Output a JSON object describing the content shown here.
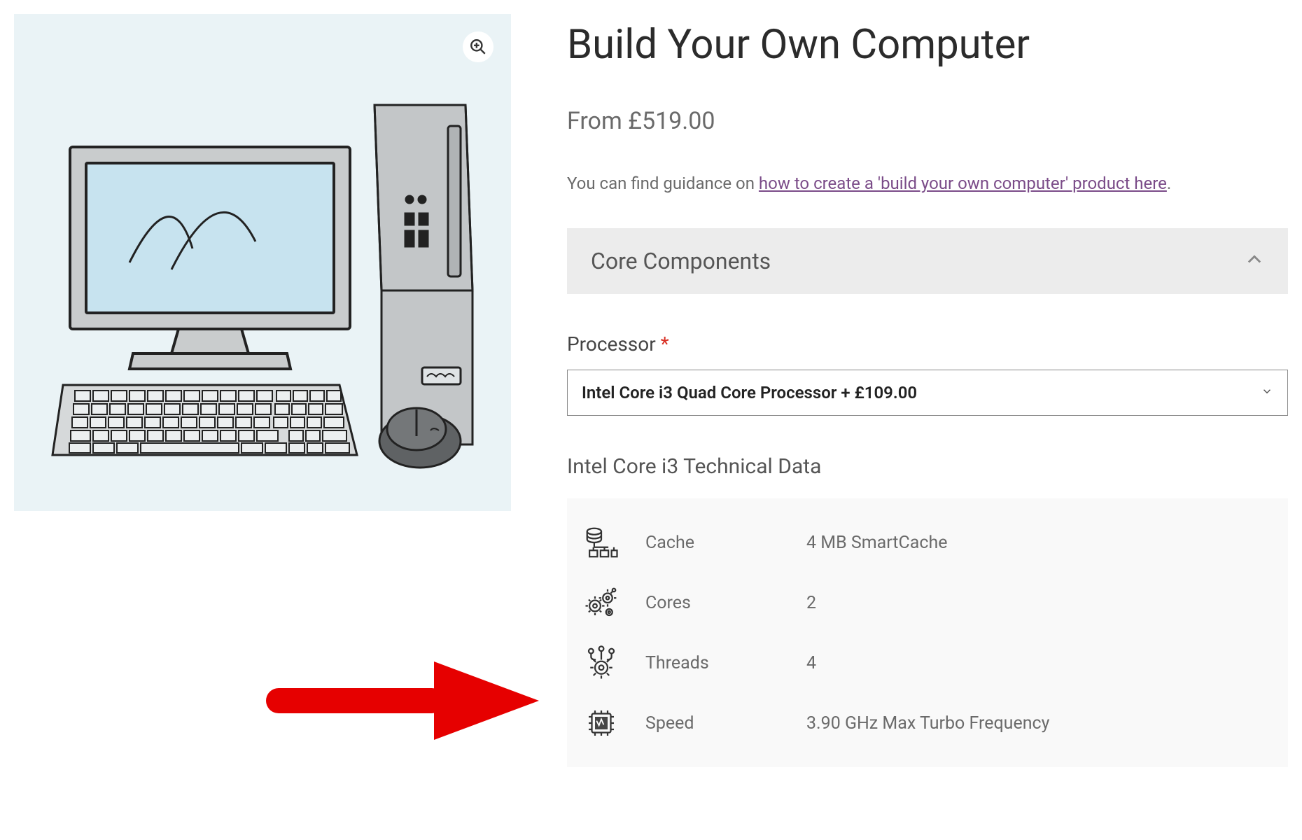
{
  "product": {
    "title": "Build Your Own Computer",
    "price_label": "From £519.00",
    "guidance_prefix": "You can find guidance on ",
    "guidance_link": "how to create a 'build your own computer' product here",
    "guidance_suffix": "."
  },
  "accordion": {
    "title": "Core Components"
  },
  "processor": {
    "label": "Processor",
    "required_mark": "*",
    "selected": "Intel Core i3 Quad Core Processor + £109.00"
  },
  "tech": {
    "title": "Intel Core i3 Technical Data",
    "rows": [
      {
        "label": "Cache",
        "value": "4 MB SmartCache"
      },
      {
        "label": "Cores",
        "value": "2"
      },
      {
        "label": "Threads",
        "value": "4"
      },
      {
        "label": "Speed",
        "value": "3.90 GHz Max Turbo Frequency"
      }
    ]
  }
}
